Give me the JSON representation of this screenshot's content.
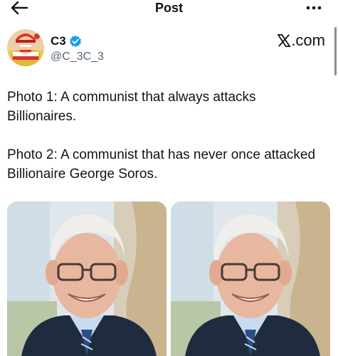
{
  "topbar": {
    "title": "Post",
    "back_icon": "arrow-left-icon",
    "more_icon": "more-horizontal-icon"
  },
  "author": {
    "name": "C3",
    "handle": "@C_3C_3",
    "verified": true,
    "verified_color": "#1d9bf0"
  },
  "source": {
    "label": ".com",
    "logo_icon": "x-logo-icon"
  },
  "tweet": {
    "paragraphs": [
      "Photo 1: A communist that always attacks Billionaires.",
      "Photo 2: A communist that has never once attacked Billionaire George Soros."
    ]
  },
  "media": {
    "photos": [
      {
        "icon": "portrait-photo"
      },
      {
        "icon": "portrait-photo"
      }
    ]
  }
}
